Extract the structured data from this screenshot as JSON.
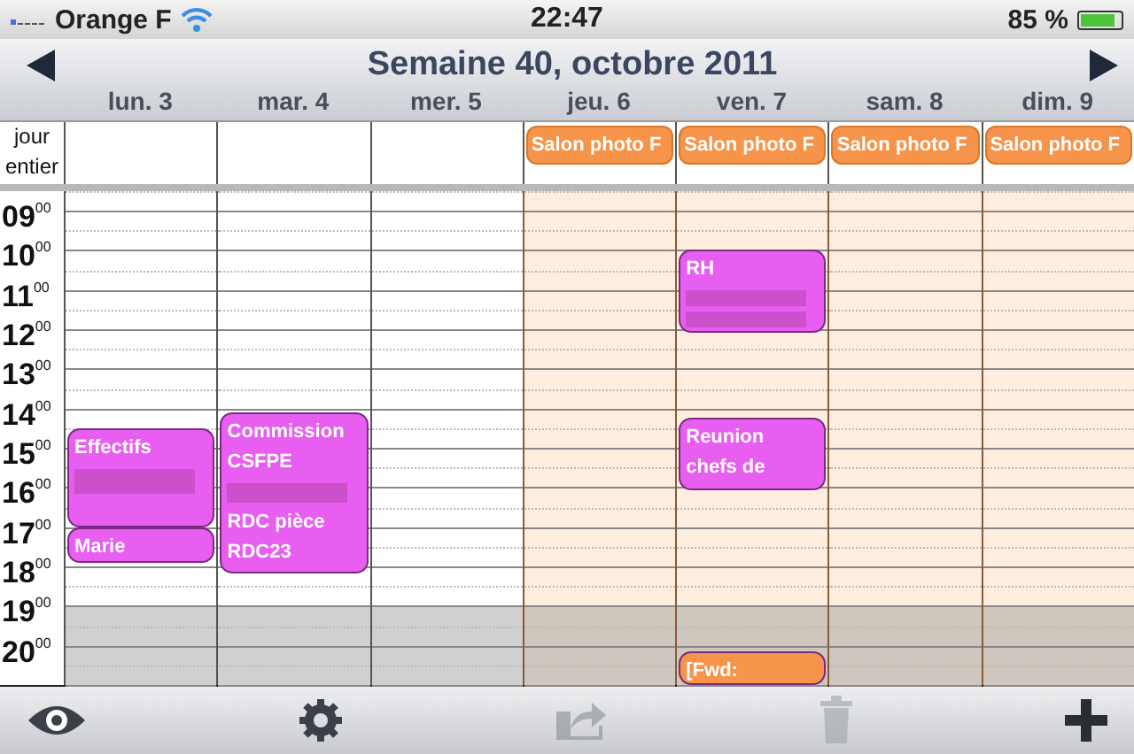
{
  "status_bar": {
    "carrier": "Orange F",
    "time": "22:47",
    "battery": "85 %"
  },
  "header": {
    "title": "Semaine 40, octobre 2011"
  },
  "all_day_label": "jour entier",
  "hours": [
    "09$^{00}$",
    "10$^{00}$",
    "11$^{00}$",
    "12$^{00}$",
    "13$^{00}$",
    "14$^{00}$",
    "15$^{00}$",
    "16$^{00}$",
    "17$^{00}$",
    "18$^{00}$",
    "19$^{00}$",
    "20$^{00}$"
  ],
  "days": [
    {
      "label": "lun. 3",
      "tinted": false,
      "events": [
        {
          "color": "#e85ef0",
          "lines": [
            {
              "kind": "text",
              "text": "Effectifs"
            },
            {
              "kind": "redacted"
            }
          ]
        },
        {
          "color": "#e85ef0",
          "lines": [
            {
              "kind": "text",
              "text": "Marie"
            }
          ]
        }
      ]
    },
    {
      "label": "mar. 4",
      "tinted": false,
      "events": [
        {
          "color": "#e85ef0",
          "lines": [
            {
              "kind": "text",
              "text": "Commission CSFPE"
            },
            {
              "kind": "redacted"
            },
            {
              "kind": "text",
              "text": "RDC pièce RDC23"
            }
          ]
        }
      ]
    },
    {
      "label": "mer. 5",
      "tinted": false
    },
    {
      "label": "jeu. 6",
      "tinted": true,
      "all_day": [
        "Salon photo F"
      ]
    },
    {
      "label": "ven. 7",
      "tinted": true,
      "all_day": [
        "Salon photo F"
      ],
      "events": [
        {
          "color": "#e85ef0",
          "lines": [
            {
              "kind": "text",
              "text": "RH"
            },
            {
              "kind": "redacted"
            },
            {
              "kind": "redacted"
            }
          ]
        },
        {
          "color": "#e85ef0",
          "lines": [
            {
              "kind": "text",
              "text": "Reunion chefs de"
            }
          ]
        },
        {
          "color": "#f5944a",
          "lines": [
            {
              "kind": "text",
              "text": "[Fwd:"
            }
          ]
        }
      ]
    },
    {
      "label": "sam. 8",
      "tinted": true,
      "all_day": [
        "Salon photo F"
      ]
    },
    {
      "label": "dim. 9",
      "tinted": true,
      "all_day": [
        "Salon photo F"
      ]
    }
  ],
  "toolbar": [
    {
      "kind": "eye",
      "disabled": false
    },
    {
      "kind": "gear",
      "disabled": false
    },
    {
      "kind": "share",
      "disabled": true
    },
    {
      "kind": "trash",
      "disabled": true
    },
    {
      "kind": "plus",
      "disabled": false
    }
  ]
}
